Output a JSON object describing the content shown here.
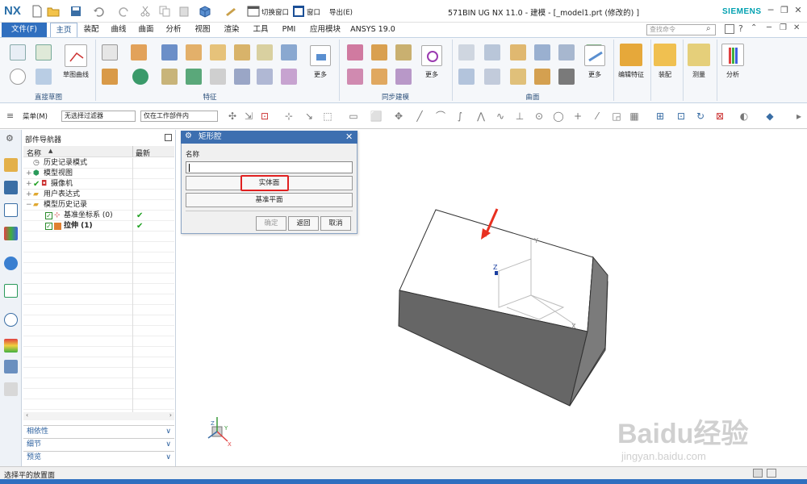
{
  "app": {
    "logo": "NX",
    "window_title": "571BIN UG NX 11.0 - 建模 - [_model1.prt  (修改的) ]",
    "brand": "SIEMENS",
    "switch_window": "切换窗口",
    "window_menu": "窗口",
    "export_menu": "导出(E)"
  },
  "menu": {
    "file": "文件(F)",
    "tabs": [
      "主页",
      "装配",
      "曲线",
      "曲面",
      "分析",
      "视图",
      "渲染",
      "工具",
      "PMI",
      "应用模块",
      "ANSYS 19.0"
    ],
    "search_placeholder": "查找命令"
  },
  "ribbon": {
    "groups": [
      "直接草图",
      "特征",
      "同步建模",
      "曲面"
    ],
    "sketch_curve": "草图曲线",
    "more": "更多",
    "edit_feature": "编辑特征",
    "assembly": "装配",
    "measure": "测量",
    "analysis": "分析"
  },
  "toolbar2": {
    "menu": "菜单(M)",
    "filter": "无选择过滤器",
    "scope": "仅在工作部件内"
  },
  "navigator": {
    "title": "部件导航器",
    "col_name": "名称",
    "col_latest": "最新",
    "items": [
      {
        "label": "历史记录模式"
      },
      {
        "label": "模型视图"
      },
      {
        "label": "摄像机"
      },
      {
        "label": "用户表达式"
      },
      {
        "label": "模型历史记录"
      },
      {
        "label": "基准坐标系 (0)"
      },
      {
        "label": "拉伸 (1)"
      }
    ],
    "sections": [
      "相依性",
      "细节",
      "预览"
    ]
  },
  "dialog": {
    "title": "矩形腔",
    "name_label": "名称",
    "name_value": "",
    "solid_face": "实体面",
    "datum_plane": "基准平面",
    "ok": "确定",
    "back": "返回",
    "cancel": "取消"
  },
  "viewport": {
    "axis_z": "Z",
    "axis_y": "Y",
    "axis_x": "X"
  },
  "status": {
    "text": "选择平的放置面"
  },
  "watermark": {
    "brand": "Baidu经验",
    "url": "jingyan.baidu.com"
  }
}
